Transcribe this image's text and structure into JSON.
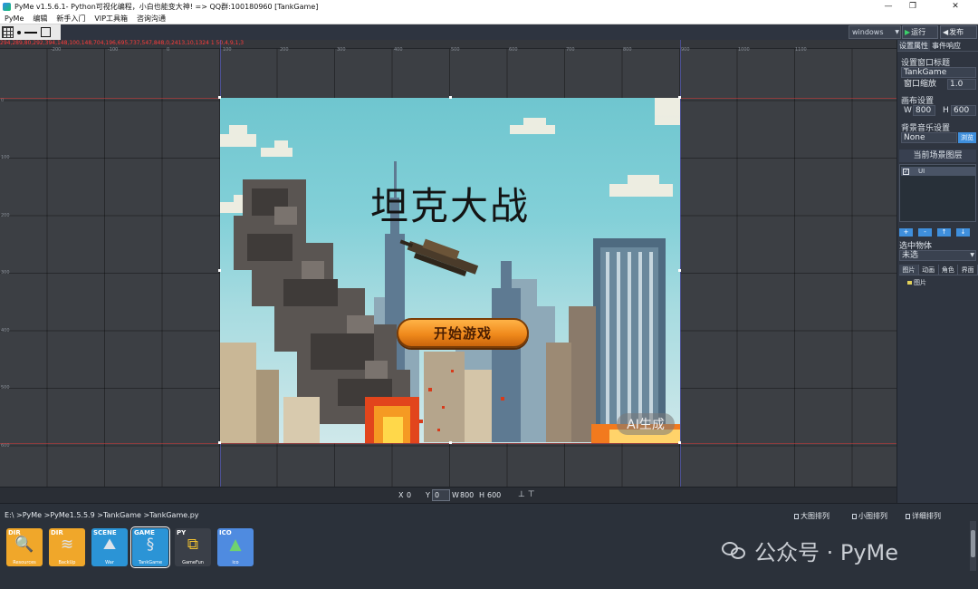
{
  "window": {
    "title": "PyMe v1.5.6.1- Python可视化编程，小白也能变大神!  => QQ群:100180960   [TankGame]",
    "minimize": "—",
    "maximize": "❐",
    "close": "✕"
  },
  "menu": [
    "PyMe",
    "编辑",
    "新手入门",
    "VIP工具箱",
    "咨询沟通"
  ],
  "toolbar": {
    "platform": "windows",
    "run_label": "运行",
    "publish_label": "发布"
  },
  "canvas": {
    "coord_readout": "294,289,80,292,394,148,100,148,704,196,695,737,547,848,0,2413,10,1324 1 50,4,9,1,3",
    "ruler_h": [
      "-200",
      "-100",
      "0",
      "100",
      "200",
      "300",
      "400",
      "500",
      "600",
      "700",
      "800",
      "900",
      "1000",
      "1100"
    ],
    "ruler_v": [
      "0",
      "100",
      "200",
      "300",
      "400",
      "500",
      "600"
    ]
  },
  "scene": {
    "title": "坦克大战",
    "start_button": "开始游戏",
    "ai_badge": "AI生成"
  },
  "selection": {
    "x_label": "X",
    "x": "0",
    "y_label": "Y",
    "y": "0",
    "w_label": "W",
    "w": "800",
    "h_label": "H",
    "h": "600"
  },
  "right_panel": {
    "tabs": [
      "设置属性",
      "事件响应"
    ],
    "window_title_label": "设置窗口标题",
    "window_title_value": "TankGame",
    "zoom_label": "窗口缩放",
    "zoom_value": "1.0",
    "canvas_label": "画布设置",
    "canvas_w_label": "W",
    "canvas_w": "800",
    "canvas_h_label": "H",
    "canvas_h": "600",
    "music_label": "背景音乐设置",
    "music_value": "None",
    "browse": "浏览",
    "layer_header": "当前场景图层",
    "layer_name": "UI",
    "layer_buttons": [
      "+",
      "-",
      "↑",
      "↓"
    ],
    "selected_label": "选中物体",
    "selected_value": "未选",
    "asset_tabs": [
      "图片",
      "动画",
      "角色",
      "界面"
    ],
    "tree_item": "图片"
  },
  "file_panel": {
    "breadcrumb": "E:\\ >PyMe >PyMe1.5.5.9 >TankGame >TankGame.py",
    "view_large": "大图排列",
    "view_small": "小图排列",
    "view_detail": "详细排列",
    "items": [
      {
        "type": "DIR",
        "name": "Resources"
      },
      {
        "type": "DIR",
        "name": "BackUp"
      },
      {
        "type": "SCENE",
        "name": "War"
      },
      {
        "type": "GAME",
        "name": "TankGame"
      },
      {
        "type": "PY",
        "name": "GameFun"
      },
      {
        "type": "ICO",
        "name": "ico"
      }
    ],
    "watermark": "公众号 · PyMe"
  },
  "colors": {
    "accent": "#3f8fdc",
    "run_icon": "#3ccf6a",
    "button_orange": "#f08a1c",
    "sky": "#6fc6cf"
  }
}
